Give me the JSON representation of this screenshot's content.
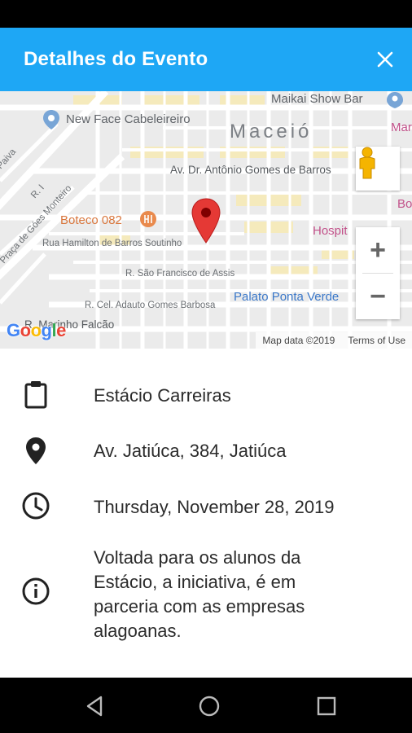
{
  "app_bar": {
    "title": "Detalhes do Evento",
    "close_icon": "close-icon",
    "background": "#1ea7f5"
  },
  "map": {
    "city_label": "Maceió",
    "pois": [
      "Maikai Show Bar",
      "New Face Cabeleireiro",
      "Boteco 082",
      "Hospit",
      "Palato Ponta Verde",
      "Maria",
      "Bo"
    ],
    "streets": [
      "Av. Dr. Antônio Gomes de Barros",
      "Rua Hamilton de Barros Soutinho",
      "R. São Francisco de Assis",
      "R. Cel. Adauto Gomes Barbosa",
      "R. Marinho Falcão",
      "Paiva",
      "R. I",
      "Praça de Góes Monteiro"
    ],
    "logo": "Google",
    "map_data_text": "Map data ©2019",
    "terms_text": "Terms of Use",
    "zoom_in_label": "+",
    "zoom_out_label": "−",
    "marker_color": "#e53935"
  },
  "event": {
    "name": "Estácio Carreiras",
    "address": "Av. Jatiúca, 384, Jatiúca",
    "date": "Thursday, November 28, 2019",
    "description": "Voltada para os alunos da Estácio, a iniciativa, é em parceria com as empresas alagoanas."
  },
  "icons": {
    "name": "clipboard-icon",
    "address": "location-pin-icon",
    "date": "clock-icon",
    "description": "info-icon"
  },
  "nav": [
    "back-icon",
    "home-icon",
    "recents-icon"
  ]
}
